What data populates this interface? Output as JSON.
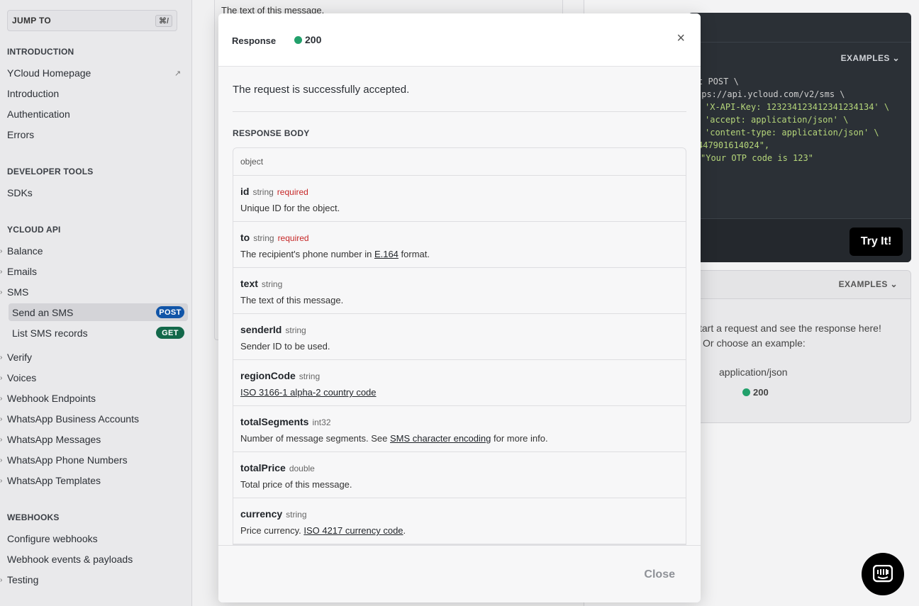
{
  "sidebar": {
    "jump_label": "JUMP TO",
    "jump_shortcut": "⌘/",
    "sections": [
      {
        "title": "INTRODUCTION",
        "items": [
          "YCloud Homepage",
          "Introduction",
          "Authentication",
          "Errors"
        ]
      },
      {
        "title": "DEVELOPER TOOLS",
        "items": [
          "SDKs"
        ]
      },
      {
        "title": "YCLOUD API",
        "items": [
          "Balance",
          "Emails",
          "SMS",
          "Verify",
          "Voices",
          "Webhook Endpoints",
          "WhatsApp Business Accounts",
          "WhatsApp Messages",
          "WhatsApp Phone Numbers",
          "WhatsApp Templates"
        ]
      },
      {
        "title": "WEBHOOKS",
        "items": [
          "Configure webhooks",
          "Webhook events & payloads",
          "Testing"
        ]
      }
    ],
    "sms_children": [
      {
        "label": "Send an SMS",
        "method": "POST"
      },
      {
        "label": "List SMS records",
        "method": "GET"
      }
    ]
  },
  "background": {
    "center_text": "The text of this message.",
    "code_examples": "EXAMPLES",
    "code_lines": [
      "t POST \\",
      "tps://api.ycloud.com/v2/sms \\",
      "'X-API-Key: 123234123412341234134' \\",
      "'accept: application/json' \\",
      "'content-type: application/json' \\",
      "",
      "",
      "447901614024\",",
      "\"Your OTP code is 123\""
    ],
    "try_label": "Try It!",
    "resp_examples": "EXAMPLES",
    "resp_line1": "tart a request and see the response here!",
    "resp_line2": "Or choose an example:",
    "resp_type": "application/json",
    "resp_code": "200"
  },
  "modal": {
    "title": "Response",
    "status_code": "200",
    "description": "The request is successfully accepted.",
    "body_heading": "RESPONSE BODY",
    "object_label": "object",
    "fields": [
      {
        "name": "id",
        "type": "string",
        "required": "required",
        "desc": "Unique ID for the object."
      },
      {
        "name": "to",
        "type": "string",
        "required": "required",
        "desc_pre": "The recipient's phone number in ",
        "desc_link": "E.164",
        "desc_post": " format."
      },
      {
        "name": "text",
        "type": "string",
        "desc": "The text of this message."
      },
      {
        "name": "senderId",
        "type": "string",
        "desc": "Sender ID to be used."
      },
      {
        "name": "regionCode",
        "type": "string",
        "desc_link": "ISO 3166-1 alpha-2 country code"
      },
      {
        "name": "totalSegments",
        "type": "int32",
        "desc_pre": "Number of message segments. See ",
        "desc_link": "SMS character encoding",
        "desc_post": " for more info."
      },
      {
        "name": "totalPrice",
        "type": "double",
        "desc": "Total price of this message."
      },
      {
        "name": "currency",
        "type": "string",
        "desc_pre": "Price currency. ",
        "desc_link": "ISO 4217 currency code",
        "desc_post": "."
      }
    ],
    "close_label": "Close"
  },
  "colors": {
    "post": "#1155a8",
    "get": "#13684a",
    "status_ok": "#22a06b",
    "required": "#c62828"
  }
}
